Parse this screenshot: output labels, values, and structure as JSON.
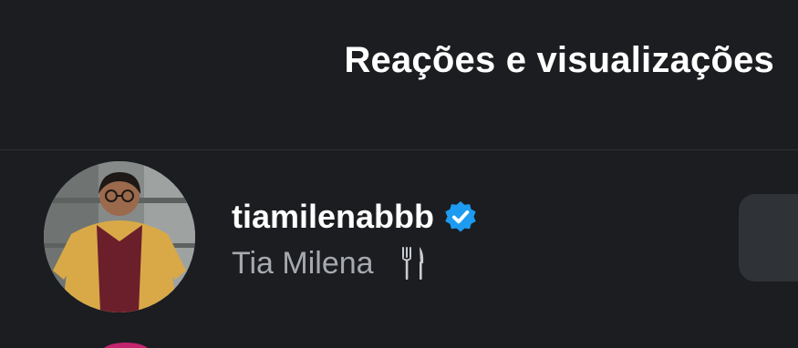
{
  "header": {
    "title": "Reações e visualizações"
  },
  "viewers": [
    {
      "username": "tiamilenabbb",
      "verified": true,
      "full_name": "Tia Milena",
      "name_emoji_icon": "fork-and-knife-icon"
    }
  ],
  "colors": {
    "background": "#1b1d20",
    "title_text": "#ffffff",
    "secondary_text": "#a6a9ae",
    "verified_badge": "#1d9bf0",
    "button_surface": "#2f3237",
    "next_avatar_ring": "#c3246e"
  }
}
